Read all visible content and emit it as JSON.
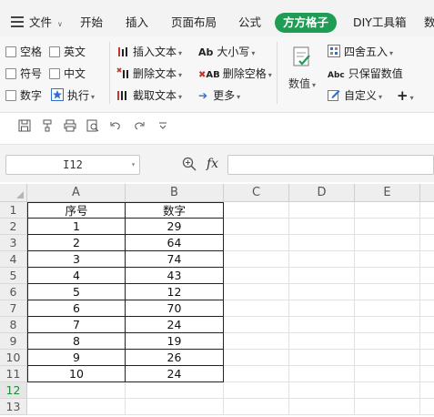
{
  "menu": {
    "file_label": "文件",
    "tabs": [
      "开始",
      "插入",
      "页面布局",
      "公式",
      "方方格子",
      "DIY工具箱",
      "数"
    ]
  },
  "ribbon": {
    "checkboxes": [
      "空格",
      "英文",
      "符号",
      "中文",
      "数字"
    ],
    "exec_label": "执行",
    "insert_text": "插入文本",
    "delete_text": "删除文本",
    "extract_text": "截取文本",
    "case_label": "大小写",
    "delete_space": "删除空格",
    "more_label": "更多",
    "value_label": "数值",
    "round_label": "四舍五入",
    "keep_value": "只保留数值",
    "custom_label": "自定义"
  },
  "formula_bar": {
    "name_box": "I12",
    "fx_label": "fx",
    "formula_value": ""
  },
  "sheet": {
    "columns": [
      "A",
      "B",
      "C",
      "D",
      "E"
    ],
    "rows": [
      "1",
      "2",
      "3",
      "4",
      "5",
      "6",
      "7",
      "8",
      "9",
      "10",
      "11",
      "12",
      "13"
    ],
    "selected_row": "12",
    "header": [
      "序号",
      "数字"
    ],
    "data": [
      [
        "1",
        "29"
      ],
      [
        "2",
        "64"
      ],
      [
        "3",
        "74"
      ],
      [
        "4",
        "43"
      ],
      [
        "5",
        "12"
      ],
      [
        "6",
        "70"
      ],
      [
        "7",
        "24"
      ],
      [
        "8",
        "19"
      ],
      [
        "9",
        "26"
      ],
      [
        "10",
        "24"
      ]
    ]
  },
  "colors": {
    "accent": "#1f9d55",
    "selected_row_text": "#1f8a3b"
  }
}
